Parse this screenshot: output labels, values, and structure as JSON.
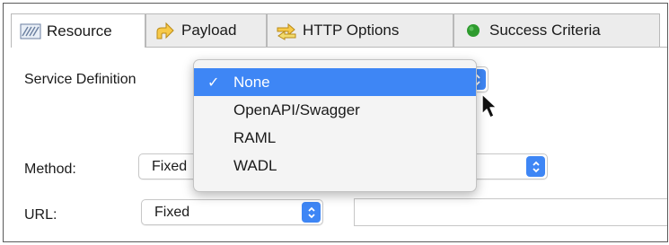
{
  "tabs": [
    {
      "label": "Resource",
      "icon": "resource-icon",
      "active": true
    },
    {
      "label": "Payload",
      "icon": "payload-icon",
      "active": false
    },
    {
      "label": "HTTP Options",
      "icon": "http-options-icon",
      "active": false
    },
    {
      "label": "Success Criteria",
      "icon": "success-criteria-icon",
      "active": false
    }
  ],
  "service_definition": {
    "label": "Service Definition",
    "selected": "None",
    "options": [
      "None",
      "OpenAPI/Swagger",
      "RAML",
      "WADL"
    ]
  },
  "method": {
    "label": "Method:",
    "value": "Fixed"
  },
  "url": {
    "label": "URL:",
    "value": "Fixed",
    "text_value": ""
  },
  "colors": {
    "accent": "#3e86f5",
    "success": "#2e9b2e"
  }
}
